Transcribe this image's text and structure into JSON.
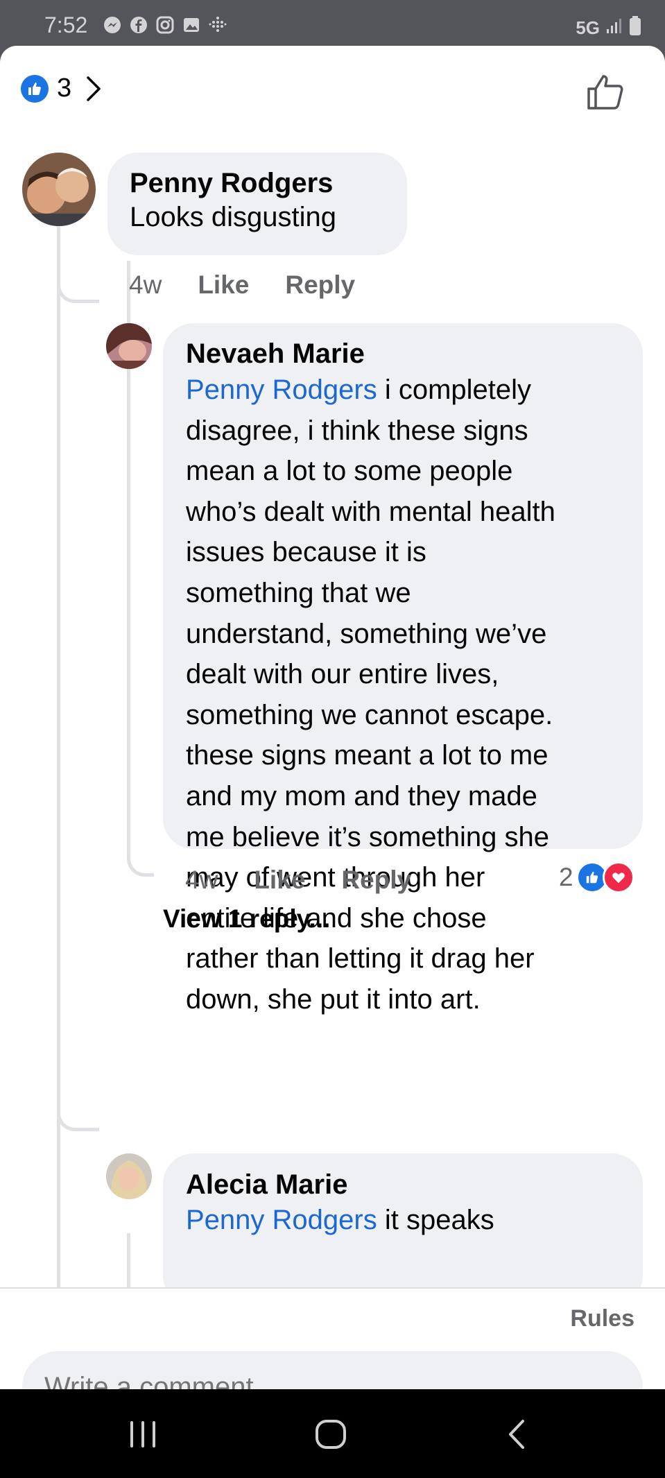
{
  "status_bar": {
    "time": "7:52",
    "network": "5G"
  },
  "header": {
    "like_count": "3"
  },
  "comments": [
    {
      "author": "Penny Rodgers",
      "text": "Looks disgusting",
      "time": "4w",
      "like_label": "Like",
      "reply_label": "Reply"
    },
    {
      "author": "Nevaeh Marie",
      "mention": "Penny Rodgers",
      "text_lines": [
        " i completely",
        "disagree, i think these signs",
        "mean a lot to some people",
        "who’s dealt with mental health",
        "issues because it is",
        "something that we",
        "understand, something we’ve",
        "dealt with our entire lives,",
        "something we cannot escape.",
        "these signs meant a lot to me",
        "and my mom and they made",
        "me believe it’s something she",
        "may of went through her",
        "entire life and she chose",
        "rather than letting it drag her",
        "down, she put it into art."
      ],
      "time": "4w",
      "like_label": "Like",
      "reply_label": "Reply",
      "reaction_count": "2",
      "view_replies": "View 1 reply..."
    },
    {
      "author": "Alecia Marie",
      "mention": "Penny Rodgers",
      "text": " it speaks"
    }
  ],
  "composer": {
    "rules_label": "Rules",
    "placeholder": "Write a comment..."
  },
  "colors": {
    "accent": "#1b74e4",
    "mention": "#1b68d2",
    "love": "#f02849",
    "bubble": "#eff0f3"
  }
}
